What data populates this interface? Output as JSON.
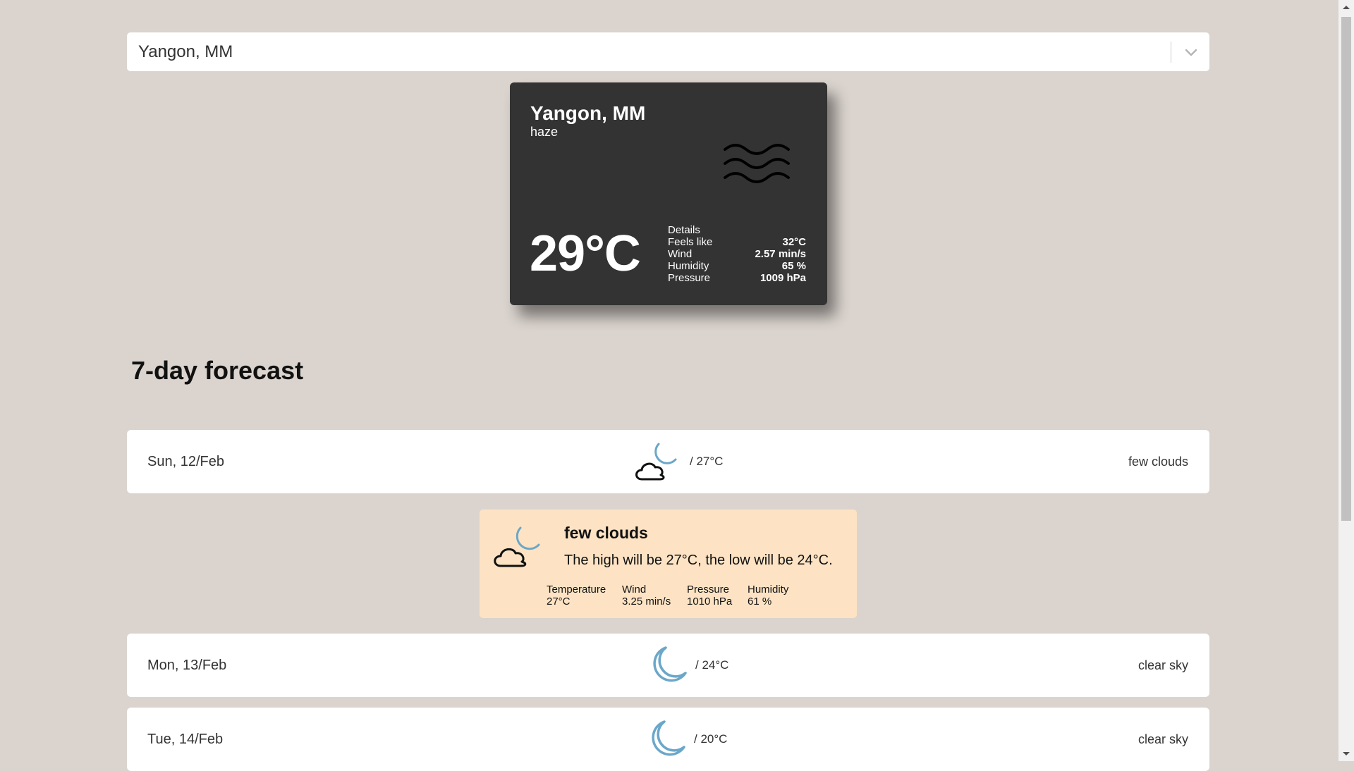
{
  "search": {
    "value": "Yangon, MM"
  },
  "current": {
    "city": "Yangon, MM",
    "description": "haze",
    "icon": "haze-icon",
    "temperature": "29°C",
    "details_title": "Details",
    "details": [
      {
        "label": "Feels like",
        "value": "32°C"
      },
      {
        "label": "Wind",
        "value": "2.57 min/s"
      },
      {
        "label": "Humidity",
        "value": "65 %"
      },
      {
        "label": "Pressure",
        "value": "1009 hPa"
      }
    ]
  },
  "forecast": {
    "title": "7-day forecast",
    "days": [
      {
        "date": "Sun, 12/Feb",
        "icon": "few-clouds-night-icon",
        "temp": "/ 27°C",
        "description": "few clouds"
      },
      {
        "date": "Mon, 13/Feb",
        "icon": "moon-icon",
        "temp": "/ 24°C",
        "description": "clear sky"
      },
      {
        "date": "Tue, 14/Feb",
        "icon": "moon-icon",
        "temp": "/ 20°C",
        "description": "clear sky"
      }
    ],
    "expanded": {
      "icon": "few-clouds-night-icon",
      "title": "few clouds",
      "summary": "The high will be 27°C, the low will be 24°C.",
      "stats": [
        {
          "label": "Temperature",
          "value": "27°C"
        },
        {
          "label": "Wind",
          "value": "3.25 min/s"
        },
        {
          "label": "Pressure",
          "value": "1010 hPa"
        },
        {
          "label": "Humidity",
          "value": "61 %"
        }
      ]
    }
  },
  "colors": {
    "background": "#dbd4ce",
    "card_dark": "#333333",
    "panel": "#fde3c4",
    "moon_blue": "#6ba7c9"
  }
}
